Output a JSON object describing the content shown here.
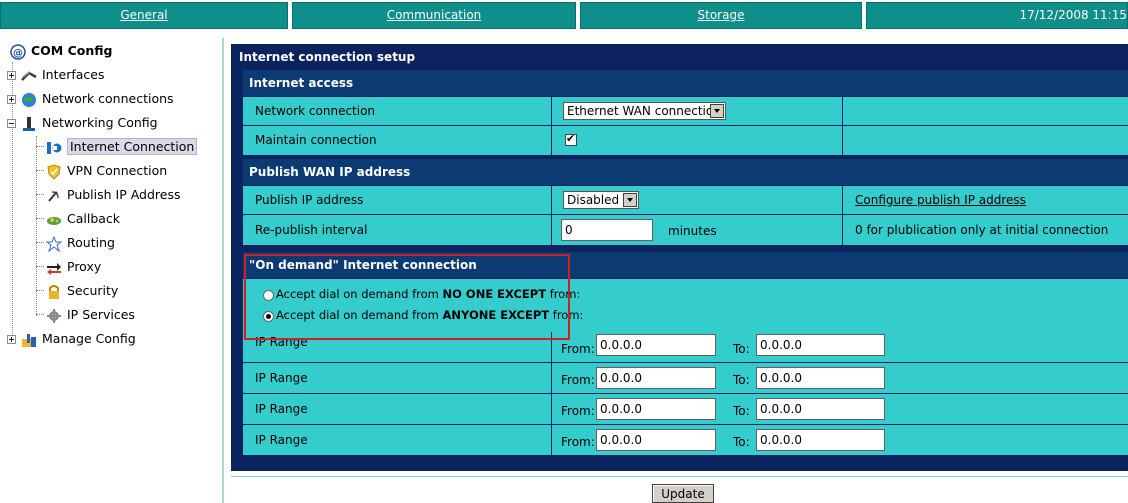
{
  "topnav": {
    "general": "General",
    "communication": "Communication",
    "storage": "Storage",
    "datetime": "17/12/2008 11:15"
  },
  "sidebar": {
    "root": "COM Config",
    "items": [
      {
        "label": "Interfaces",
        "icon": "interfaces-icon"
      },
      {
        "label": "Network connections",
        "icon": "globe-icon"
      },
      {
        "label": "Networking Config",
        "icon": "networking-icon"
      },
      {
        "label": "Internet Connection",
        "icon": "internet-connection-icon",
        "selected": true
      },
      {
        "label": "VPN Connection",
        "icon": "shield-icon"
      },
      {
        "label": "Publish IP Address",
        "icon": "satellite-icon"
      },
      {
        "label": "Callback",
        "icon": "callback-icon"
      },
      {
        "label": "Routing",
        "icon": "routing-icon"
      },
      {
        "label": "Proxy",
        "icon": "proxy-icon"
      },
      {
        "label": "Security",
        "icon": "lock-icon"
      },
      {
        "label": "IP Services",
        "icon": "gear-icon"
      },
      {
        "label": "Manage Config",
        "icon": "manage-config-icon"
      }
    ]
  },
  "main": {
    "title": "Internet connection setup",
    "internet_access": {
      "header": "Internet access",
      "network_connection_label": "Network connection",
      "network_connection_value": "Ethernet WAN connection",
      "maintain_connection_label": "Maintain connection",
      "maintain_connection_checked": true
    },
    "publish": {
      "header": "Publish WAN IP address",
      "publish_ip_label": "Publish IP address",
      "publish_ip_value": "Disabled",
      "configure_link": "Configure publish IP address",
      "republish_label": "Re-publish interval",
      "republish_value": "0",
      "republish_unit": "minutes",
      "republish_hint": "0 for plublication only at initial connection"
    },
    "ondemand": {
      "header": "\"On demand\" Internet connection",
      "option1_prefix": "Accept dial on demand from ",
      "option1_bold": "NO ONE EXCEPT",
      "option1_suffix": " from:",
      "option2_prefix": "Accept dial on demand from ",
      "option2_bold": "ANYONE EXCEPT",
      "option2_suffix": " from:",
      "selected_option": 2
    },
    "ranges": [
      {
        "label": "IP Range",
        "from_label": "From:",
        "from": "0.0.0.0",
        "to_label": "To:",
        "to": "0.0.0.0"
      },
      {
        "label": "IP Range",
        "from_label": "From:",
        "from": "0.0.0.0",
        "to_label": "To:",
        "to": "0.0.0.0"
      },
      {
        "label": "IP Range",
        "from_label": "From:",
        "from": "0.0.0.0",
        "to_label": "To:",
        "to": "0.0.0.0"
      },
      {
        "label": "IP Range",
        "from_label": "From:",
        "from": "0.0.0.0",
        "to_label": "To:",
        "to": "0.0.0.0"
      }
    ],
    "update_label": "Update"
  }
}
